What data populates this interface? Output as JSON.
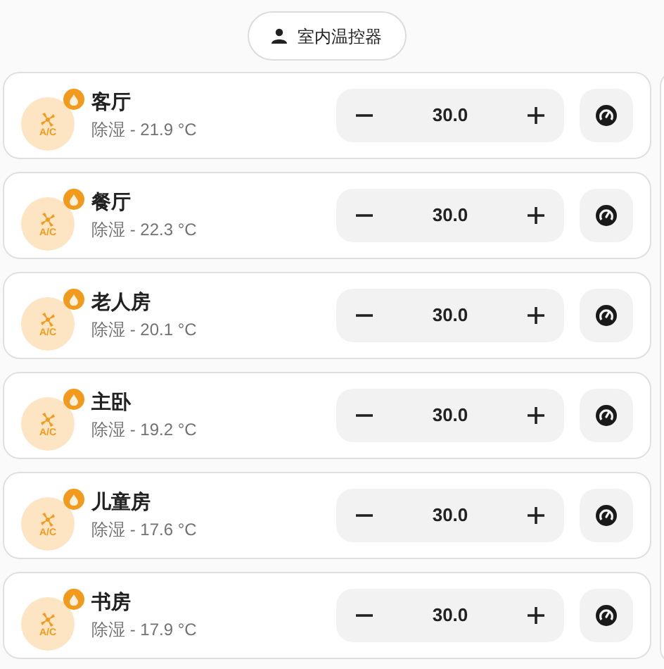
{
  "header_chip": {
    "label": "室内温控器"
  },
  "rooms": [
    {
      "icon_label": "A/C",
      "name": "客厅",
      "status": "除湿 - 21.9 °C",
      "setpoint": "30.0"
    },
    {
      "icon_label": "A/C",
      "name": "餐厅",
      "status": "除湿 - 22.3 °C",
      "setpoint": "30.0"
    },
    {
      "icon_label": "A/C",
      "name": "老人房",
      "status": "除湿 - 20.1 °C",
      "setpoint": "30.0"
    },
    {
      "icon_label": "A/C",
      "name": "主卧",
      "status": "除湿 - 19.2 °C",
      "setpoint": "30.0"
    },
    {
      "icon_label": "A/C",
      "name": "儿童房",
      "status": "除湿 - 17.6 °C",
      "setpoint": "30.0"
    },
    {
      "icon_label": "A/C",
      "name": "书房",
      "status": "除湿 - 17.9 °C",
      "setpoint": "30.0"
    }
  ]
}
